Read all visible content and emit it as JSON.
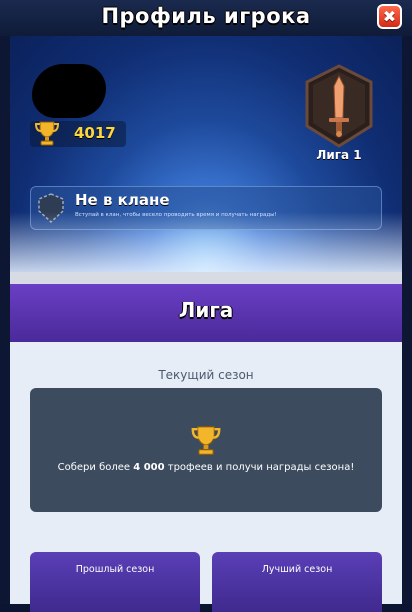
{
  "window": {
    "title": "Профиль игрока",
    "close_glyph": "✖"
  },
  "profile": {
    "trophies": "4017",
    "league_label": "Лига 1",
    "clan": {
      "title": "Не в клане",
      "subtitle": "Вступай в клан, чтобы весело проводить время и получать награды!"
    }
  },
  "league_section": {
    "header": "Лига",
    "current_season_label": "Текущий сезон",
    "card_text_prefix": "Собери более ",
    "card_text_bold": "4 000",
    "card_text_suffix": " трофеев и получи награды сезона!",
    "past_season_label": "Прошлый сезон",
    "best_season_label": "Лучший сезон"
  },
  "icons": {
    "trophy": "trophy-icon",
    "league_badge": "sword-shield-icon",
    "clan": "empty-clan-shield-icon",
    "close": "close-icon"
  },
  "colors": {
    "trophy_count": "#ffd63a",
    "league_header": "#5a35b0",
    "season_card": "#3c4b5e",
    "close_button": "#e23a21"
  }
}
